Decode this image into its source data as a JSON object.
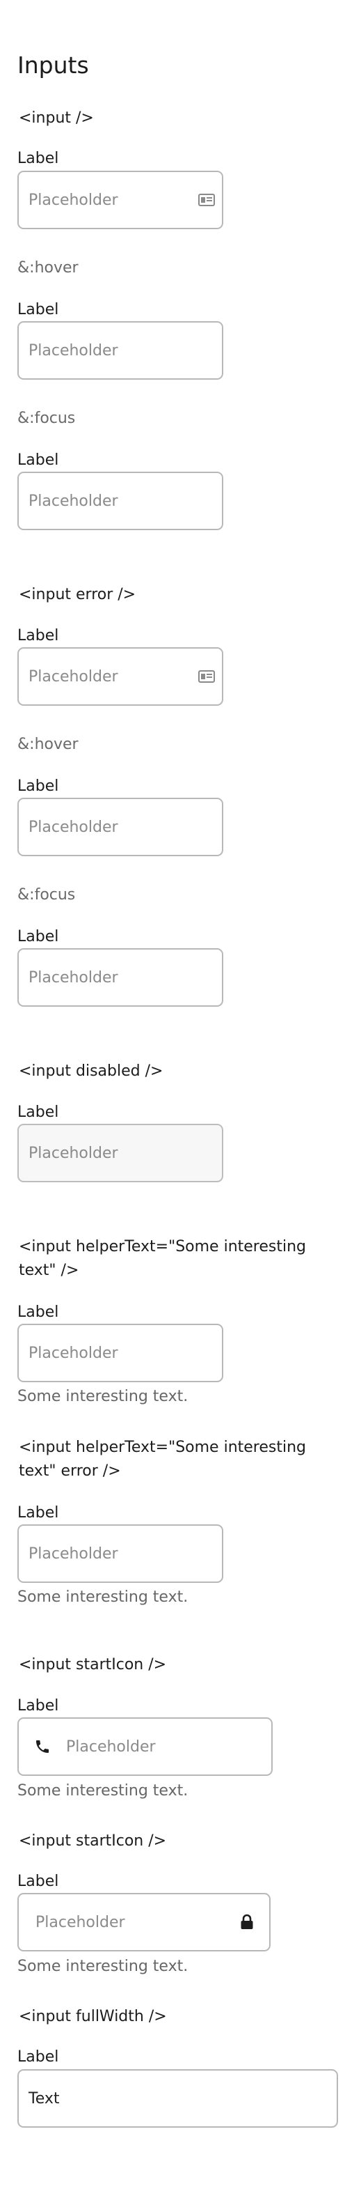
{
  "page": {
    "title": "Inputs"
  },
  "label": "Label",
  "placeholder": "Placeholder",
  "states": {
    "hover": "&:hover",
    "focus": "&:focus"
  },
  "sections": {
    "default": "<input />",
    "error": "<input error />",
    "disabled": "<input disabled />",
    "helper": "<input helperText=\"Some interesting text\" />",
    "helper_error": "<input helperText=\"Some interesting text\" error />",
    "start_icon": "<input startIcon />",
    "start_icon_2": "<input startIcon />",
    "full_width": "<input fullWidth />"
  },
  "helper_text": "Some interesting text.",
  "full_width_value": "Text",
  "icons": {
    "card": "id-card-icon",
    "phone": "phone-icon",
    "lock": "lock-icon"
  }
}
